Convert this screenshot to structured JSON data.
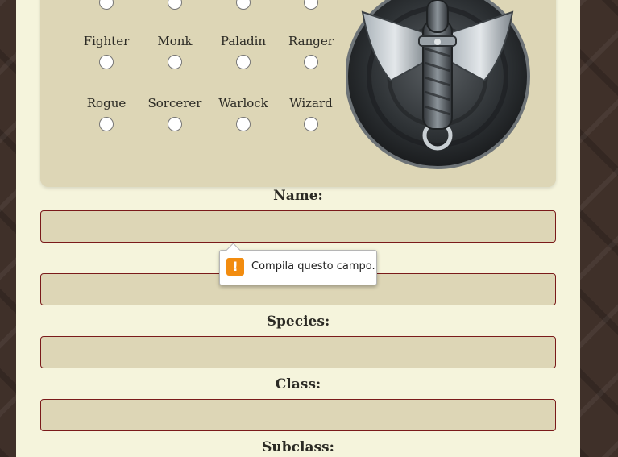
{
  "classes": {
    "row1": [
      "Fighter",
      "Monk",
      "Paladin",
      "Ranger"
    ],
    "row2": [
      "Rogue",
      "Sorcerer",
      "Warlock",
      "Wizard"
    ]
  },
  "form": {
    "name_label": "Name:",
    "species_label": "Species:",
    "class_label": "Class:",
    "subclass_label": "Subclass:"
  },
  "validation": {
    "message": "Compila questo campo.",
    "icon": "warning-icon"
  },
  "emblem": {
    "icon": "dagger-emblem-icon"
  },
  "colors": {
    "page_bg": "#f5f4dc",
    "panel_bg": "#ddd6b6",
    "input_border": "#7a1a1a",
    "warning": "#f28c0f"
  }
}
